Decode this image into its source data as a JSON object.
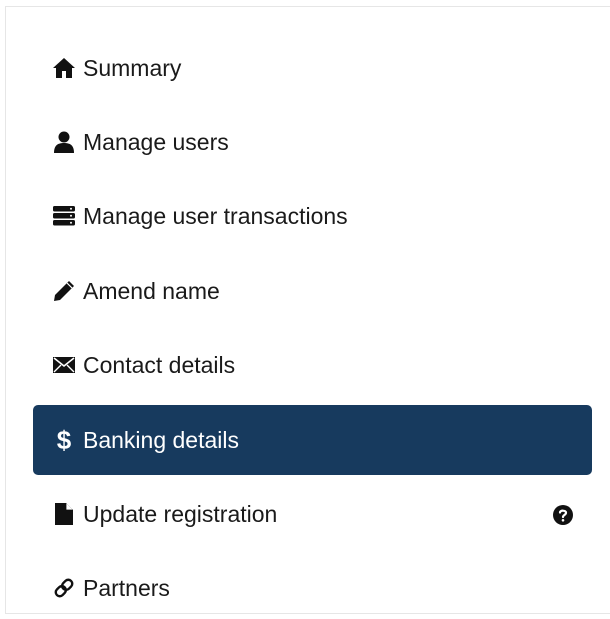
{
  "nav": {
    "items": [
      {
        "label": "Summary",
        "icon": "home-icon",
        "active": false
      },
      {
        "label": "Manage users",
        "icon": "user-icon",
        "active": false
      },
      {
        "label": "Manage user transactions",
        "icon": "server-stack-icon",
        "active": false
      },
      {
        "label": "Amend name",
        "icon": "pencil-icon",
        "active": false
      },
      {
        "label": "Contact details",
        "icon": "envelope-icon",
        "active": false
      },
      {
        "label": "Banking details",
        "icon": "dollar-icon",
        "dollar_glyph": "$",
        "active": true
      },
      {
        "label": "Update registration",
        "icon": "document-icon",
        "help_icon": "question-circle-icon",
        "active": false
      },
      {
        "label": "Partners",
        "icon": "link-icon",
        "active": false
      }
    ],
    "active_color": "#173a5e",
    "text_color": "#1a1a1a"
  }
}
